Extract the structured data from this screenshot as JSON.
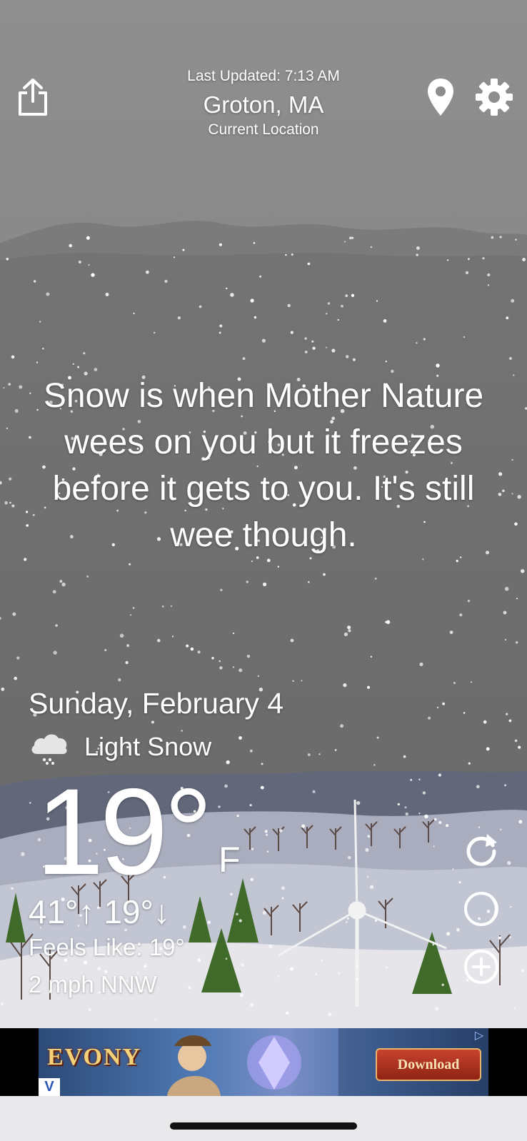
{
  "header": {
    "last_updated": "Last Updated: 7:13 AM",
    "city": "Groton, MA",
    "location_label": "Current Location",
    "share_icon": "share-icon",
    "location_icon": "location-pin-icon",
    "settings_icon": "gear-icon"
  },
  "quote": "Snow is when Mother Nature wees on you but it freezes before it gets to you. It's still wee though.",
  "weather": {
    "date": "Sunday, February 4",
    "condition_icon": "light-snow-cloud-icon",
    "condition": "Light Snow",
    "temperature": "19°",
    "unit": "F",
    "high_low": "41°↑ 19°↓",
    "feels_like": "Feels Like: 19°",
    "wind": "2 mph NNW"
  },
  "side_buttons": {
    "refresh_icon": "refresh-icon",
    "moon_icon": "moon-icon",
    "add_icon": "add-location-icon"
  },
  "ad": {
    "brand": "EVONY",
    "button": "Download",
    "badge": "V",
    "choices_icon": "ad-choices-icon"
  },
  "colors": {
    "sky_top": "#8f8f8f",
    "sky_main": "#6f6f6f",
    "hills": "#5f6577",
    "snow_ground": "#e8e8ec",
    "tree_green": "#3f6a2a"
  }
}
